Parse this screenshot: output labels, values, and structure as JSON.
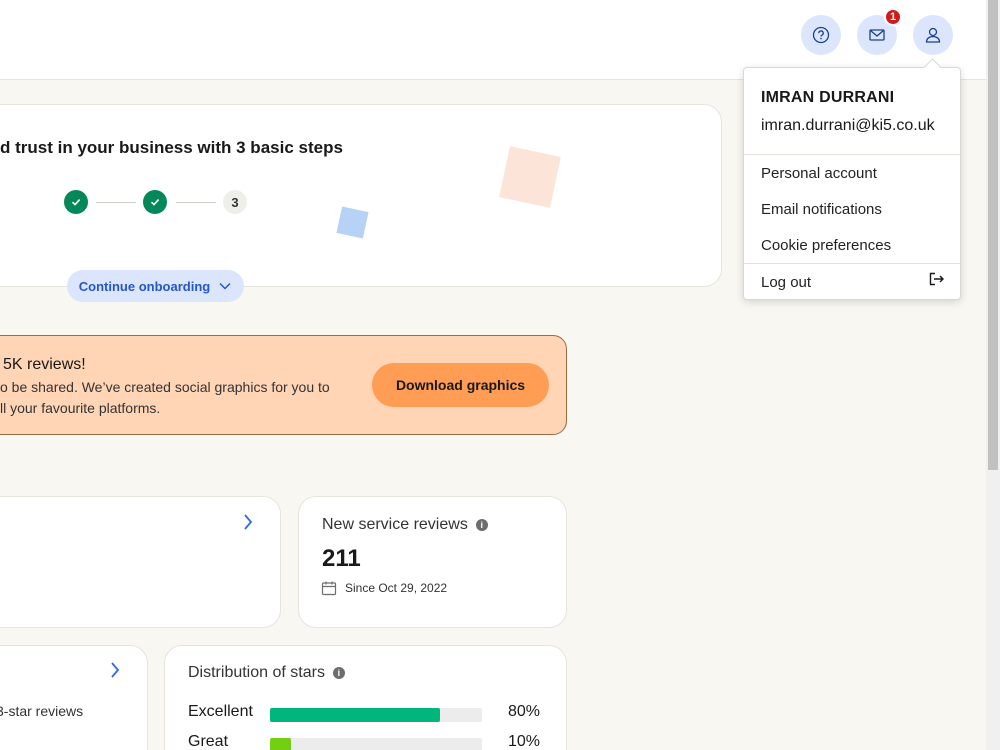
{
  "header": {
    "notification_count": "1",
    "icons": [
      "help-icon",
      "mail-icon",
      "user-icon"
    ]
  },
  "onboarding": {
    "title": "d trust in your business with 3 basic steps",
    "step3_label": "3",
    "continue_label": "Continue onboarding"
  },
  "banner": {
    "title": "5K reviews!",
    "text_line1": "o be shared. We’ve created social graphics for you to",
    "text_line2": "ll your favourite platforms.",
    "download_label": "Download graphics",
    "bg_color": "#ffd5b5",
    "button_color": "#ff9d55"
  },
  "service_reviews": {
    "label": "New service reviews",
    "value": "211",
    "since": "Since Oct 29, 2022"
  },
  "left_card": {
    "text": "3-star reviews"
  },
  "distribution": {
    "label": "Distribution of stars",
    "rows": [
      {
        "label": "Excellent",
        "percent": "80%",
        "value": 80,
        "color": "#00b67a"
      },
      {
        "label": "Great",
        "percent": "10%",
        "value": 10,
        "color": "#73cf11"
      }
    ]
  },
  "account_menu": {
    "name": "IMRAN DURRANI",
    "email": "imran.durrani@ki5.co.uk",
    "items": [
      "Personal account",
      "Email notifications",
      "Cookie preferences"
    ],
    "logout": "Log out"
  }
}
